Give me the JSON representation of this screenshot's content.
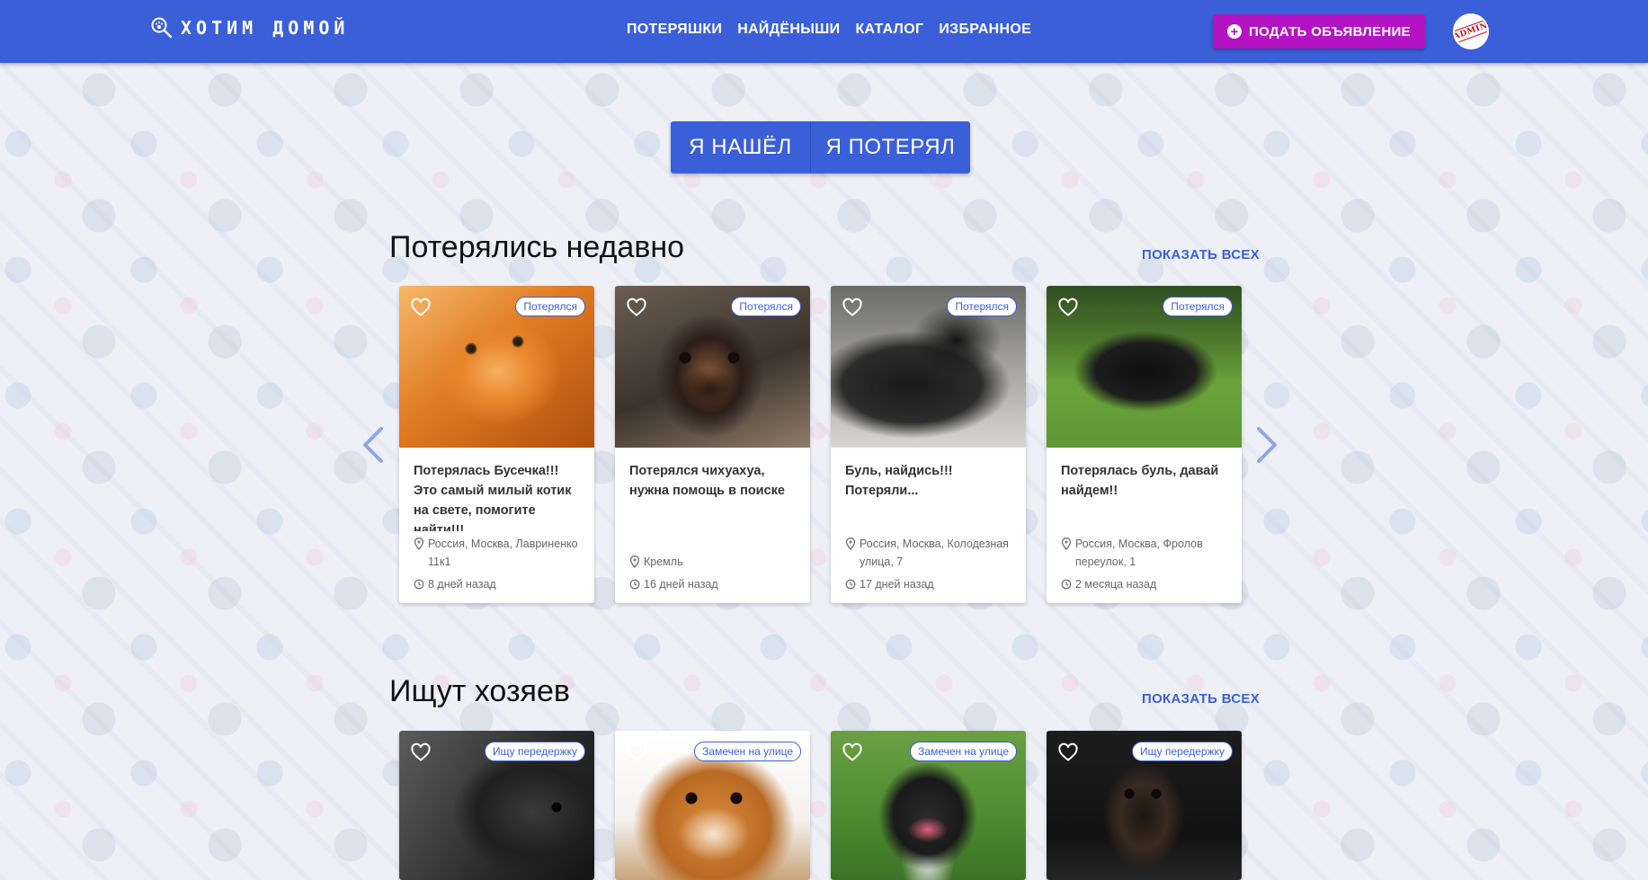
{
  "header": {
    "logo_text": "ХОТИМ ДОМОЙ",
    "nav": [
      "ПОТЕРЯШКИ",
      "НАЙДЁНЫШИ",
      "КАТАЛОГ",
      "ИЗБРАННОЕ"
    ],
    "add_button": "ПОДАТЬ ОБЪЯВЛЕНИЕ",
    "avatar_text": "ADMIN"
  },
  "toggle": {
    "found": "Я НАШЁЛ",
    "lost": "Я ПОТЕРЯЛ"
  },
  "lost_section": {
    "title": "Потерялись недавно",
    "show_all": "ПОКАЗАТЬ ВСЕХ",
    "cards": [
      {
        "badge": "Потерялся",
        "title": "Потерялась Бусечка!!! Это самый милый котик на свете, помогите найти!!!",
        "location": "Россия, Москва, Лавриненко 11к1",
        "time": "8 дней назад"
      },
      {
        "badge": "Потерялся",
        "title": "Потерялся чихуахуа, нужна помощь в поиске",
        "location": "Кремль",
        "time": "16 дней назад"
      },
      {
        "badge": "Потерялся",
        "title": "Буль, найдись!!! Потеряли...",
        "location": "Россия, Москва, Колодезная улица, 7",
        "time": "17 дней назад"
      },
      {
        "badge": "Потерялся",
        "title": "Потерялась буль, давай найдем!!",
        "location": "Россия, Москва, Фролов переулок, 1",
        "time": "2 месяца назад"
      }
    ]
  },
  "owners_section": {
    "title": "Ищут хозяев",
    "show_all": "ПОКАЗАТЬ ВСЕХ",
    "cards": [
      {
        "badge": "Ищу передержку"
      },
      {
        "badge": "Замечен на улице"
      },
      {
        "badge": "Замечен на улице"
      },
      {
        "badge": "Ищу передержку"
      }
    ]
  },
  "colors": {
    "primary": "#3a5fd8",
    "accent": "#b413c4"
  }
}
